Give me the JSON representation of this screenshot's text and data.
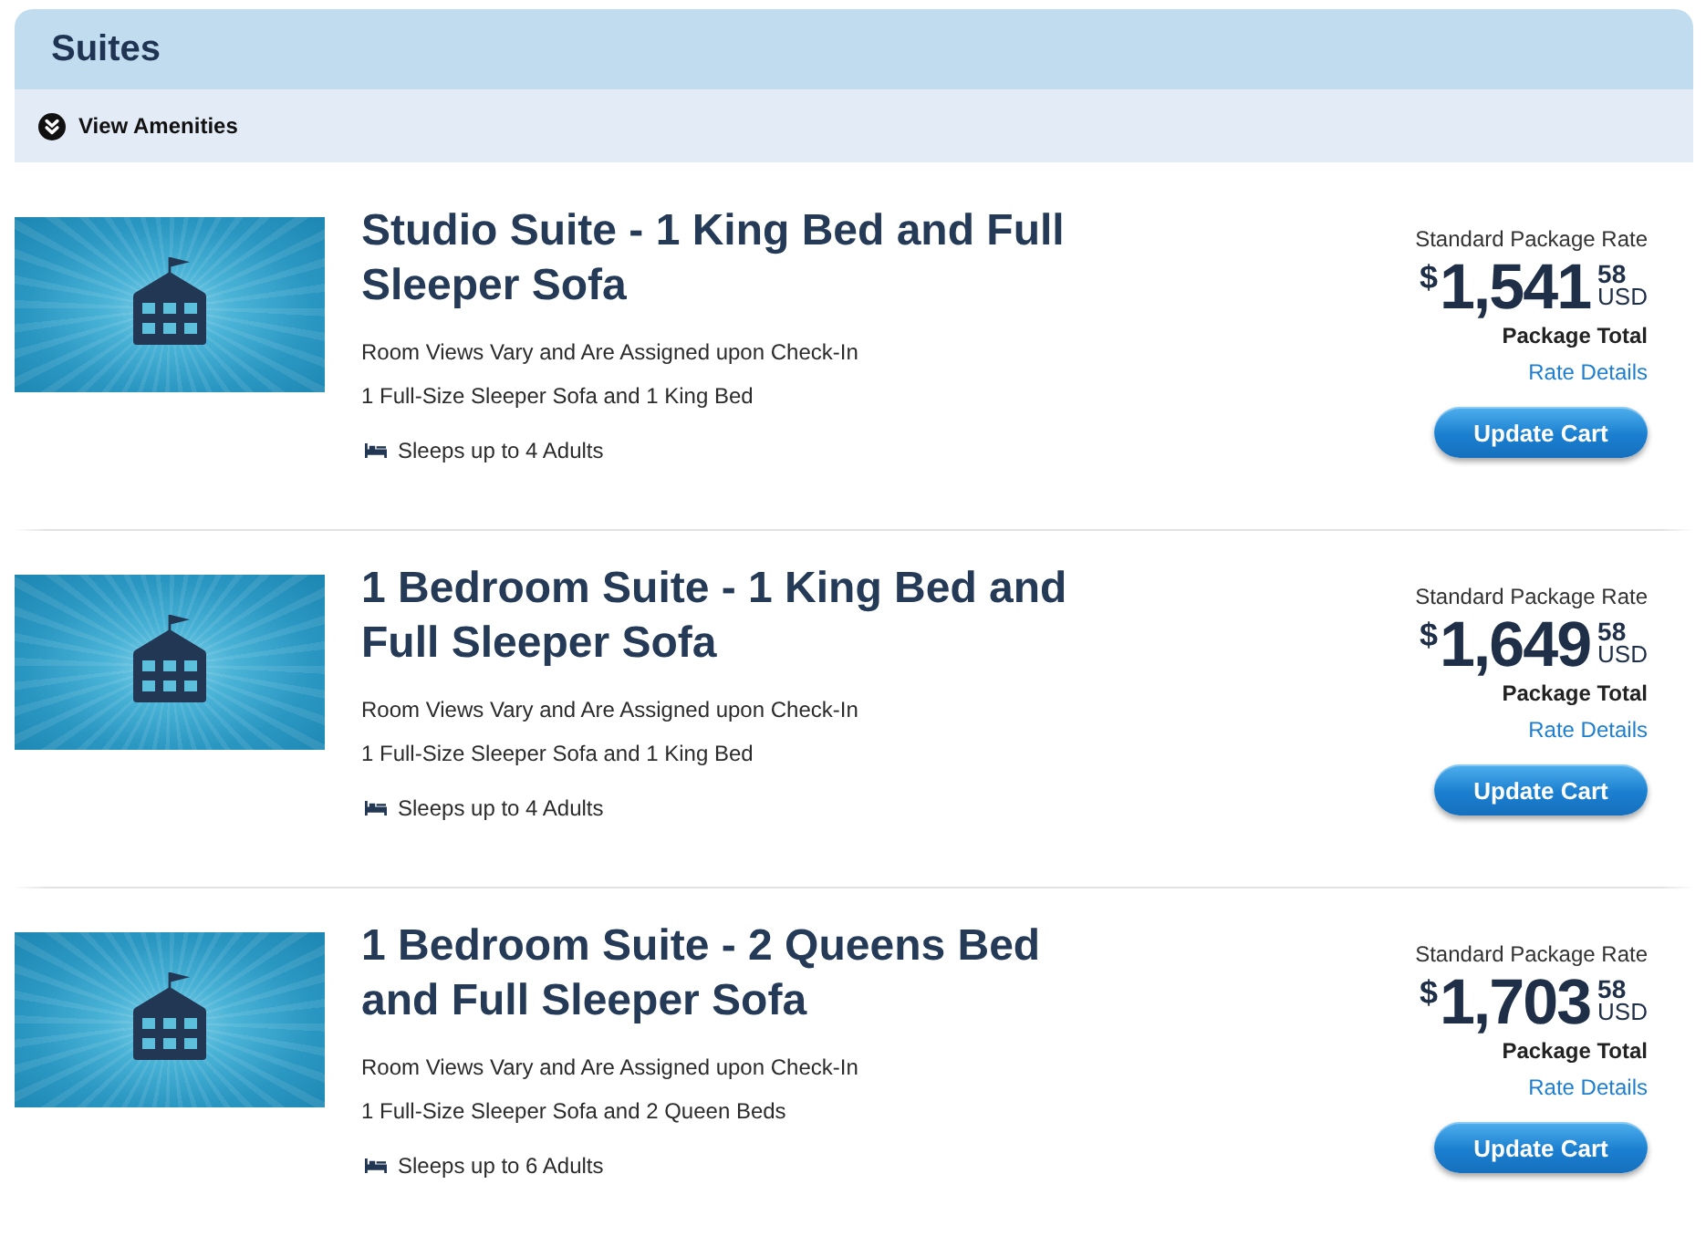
{
  "section": {
    "title": "Suites",
    "amenities_toggle": {
      "label": "View Amenities",
      "expanded": false
    }
  },
  "rooms": [
    {
      "title": "Studio Suite - 1 King Bed and Full Sleeper Sofa",
      "details": [
        "Room Views Vary and Are Assigned upon Check-In",
        "1 Full-Size Sleeper Sofa and 1 King Bed"
      ],
      "sleeps": "Sleeps up to 4 Adults",
      "rate_label": "Standard Package Rate",
      "price": {
        "symbol": "$",
        "amount": "1,541",
        "cents": "58",
        "currency": "USD"
      },
      "total_label": "Package Total",
      "rate_link": "Rate Details",
      "button": "Update Cart"
    },
    {
      "title": "1 Bedroom Suite - 1 King Bed and Full Sleeper Sofa",
      "details": [
        "Room Views Vary and Are Assigned upon Check-In",
        "1 Full-Size Sleeper Sofa and 1 King Bed"
      ],
      "sleeps": "Sleeps up to 4 Adults",
      "rate_label": "Standard Package Rate",
      "price": {
        "symbol": "$",
        "amount": "1,649",
        "cents": "58",
        "currency": "USD"
      },
      "total_label": "Package Total",
      "rate_link": "Rate Details",
      "button": "Update Cart"
    },
    {
      "title": "1 Bedroom Suite - 2 Queens Bed and Full Sleeper Sofa",
      "details": [
        "Room Views Vary and Are Assigned upon Check-In",
        "1 Full-Size Sleeper Sofa and 2 Queen Beds"
      ],
      "sleeps": "Sleeps up to 6 Adults",
      "rate_label": "Standard Package Rate",
      "price": {
        "symbol": "$",
        "amount": "1,703",
        "cents": "58",
        "currency": "USD"
      },
      "total_label": "Package Total",
      "rate_link": "Rate Details",
      "button": "Update Cart"
    }
  ]
}
